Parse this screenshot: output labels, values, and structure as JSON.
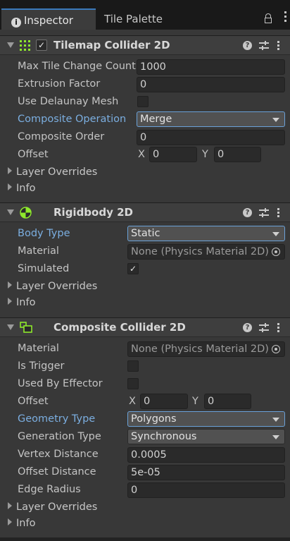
{
  "tabs": {
    "inspector": "Inspector",
    "tile_palette": "Tile Palette",
    "inspector_icon": "i"
  },
  "tilemap_collider": {
    "title": "Tilemap Collider 2D",
    "enabled": "✓",
    "max_tile_change_count_label": "Max Tile Change Count",
    "max_tile_change_count": "1000",
    "extrusion_factor_label": "Extrusion Factor",
    "extrusion_factor": "0",
    "use_delaunay_label": "Use Delaunay Mesh",
    "composite_operation_label": "Composite Operation",
    "composite_operation": "Merge",
    "composite_order_label": "Composite Order",
    "composite_order": "0",
    "offset_label": "Offset",
    "offset_x_label": "X",
    "offset_x": "0",
    "offset_y_label": "Y",
    "offset_y": "0",
    "layer_overrides": "Layer Overrides",
    "info": "Info"
  },
  "rigidbody": {
    "title": "Rigidbody 2D",
    "body_type_label": "Body Type",
    "body_type": "Static",
    "material_label": "Material",
    "material": "None (Physics Material 2D)",
    "simulated_label": "Simulated",
    "simulated": "✓",
    "layer_overrides": "Layer Overrides",
    "info": "Info"
  },
  "composite_collider": {
    "title": "Composite Collider 2D",
    "material_label": "Material",
    "material": "None (Physics Material 2D)",
    "is_trigger_label": "Is Trigger",
    "used_by_effector_label": "Used By Effector",
    "offset_label": "Offset",
    "offset_x_label": "X",
    "offset_x": "0",
    "offset_y_label": "Y",
    "offset_y": "0",
    "geometry_type_label": "Geometry Type",
    "geometry_type": "Polygons",
    "generation_type_label": "Generation Type",
    "generation_type": "Synchronous",
    "vertex_distance_label": "Vertex Distance",
    "vertex_distance": "0.0005",
    "offset_distance_label": "Offset Distance",
    "offset_distance": "5e-05",
    "edge_radius_label": "Edge Radius",
    "edge_radius": "0",
    "layer_overrides": "Layer Overrides",
    "info": "Info"
  },
  "header_help": "?",
  "colors": {
    "accent": "#3a79bb",
    "modified_label": "#7baee0",
    "component_icon": "#8ee82c"
  },
  "icons": [
    "info-icon",
    "lock-icon",
    "menu-icon",
    "grid-icon",
    "rigidbody-icon",
    "composite-collider-icon",
    "help-icon",
    "preset-icon",
    "object-picker-icon"
  ]
}
